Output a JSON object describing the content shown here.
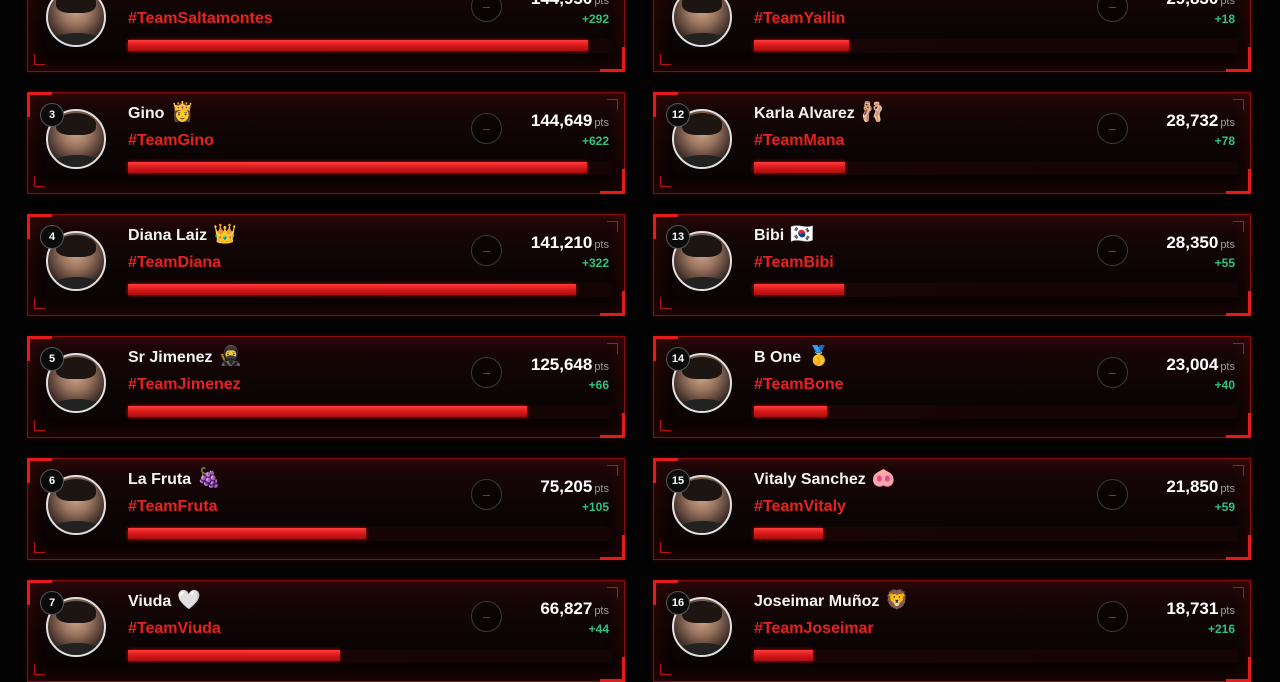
{
  "unit_label": "pts",
  "accent_color": "#e52222",
  "delta_color": "#2ec27e",
  "left_column": [
    {
      "rank": "",
      "name": "",
      "emoji": "",
      "team": "#TeamSaltamontes",
      "points": "144,950",
      "delta": "+292",
      "progress": 1.0
    },
    {
      "rank": "3",
      "name": "Gino",
      "emoji": "👸",
      "team": "#TeamGino",
      "points": "144,649",
      "delta": "+622",
      "progress": 0.998
    },
    {
      "rank": "4",
      "name": "Diana Laiz",
      "emoji": "👑",
      "team": "#TeamDiana",
      "points": "141,210",
      "delta": "+322",
      "progress": 0.974
    },
    {
      "rank": "5",
      "name": "Sr Jimenez",
      "emoji": "🥷",
      "team": "#TeamJimenez",
      "points": "125,648",
      "delta": "+66",
      "progress": 0.867
    },
    {
      "rank": "6",
      "name": "La Fruta",
      "emoji": "🍇",
      "team": "#TeamFruta",
      "points": "75,205",
      "delta": "+105",
      "progress": 0.518
    },
    {
      "rank": "7",
      "name": "Viuda",
      "emoji": "🤍",
      "team": "#TeamViuda",
      "points": "66,827",
      "delta": "+44",
      "progress": 0.461
    }
  ],
  "right_column": [
    {
      "rank": "",
      "name": "",
      "emoji": "🎀",
      "team": "#TeamYailin",
      "points": "29,830",
      "delta": "+18",
      "progress": 0.206
    },
    {
      "rank": "12",
      "name": "Karla Alvarez",
      "emoji": "🩰",
      "team": "#TeamMana",
      "points": "28,732",
      "delta": "+78",
      "progress": 0.198
    },
    {
      "rank": "13",
      "name": "Bibi",
      "emoji": "🇰🇷",
      "team": "#TeamBibi",
      "points": "28,350",
      "delta": "+55",
      "progress": 0.196
    },
    {
      "rank": "14",
      "name": "B One",
      "emoji": "🥇",
      "team": "#TeamBone",
      "points": "23,004",
      "delta": "+40",
      "progress": 0.159
    },
    {
      "rank": "15",
      "name": "Vitaly Sanchez",
      "emoji": "🐽",
      "team": "#TeamVitaly",
      "points": "21,850",
      "delta": "+59",
      "progress": 0.151
    },
    {
      "rank": "16",
      "name": "Joseimar Muñoz",
      "emoji": "🦁",
      "team": "#TeamJoseimar",
      "points": "18,731",
      "delta": "+216",
      "progress": 0.129
    }
  ]
}
